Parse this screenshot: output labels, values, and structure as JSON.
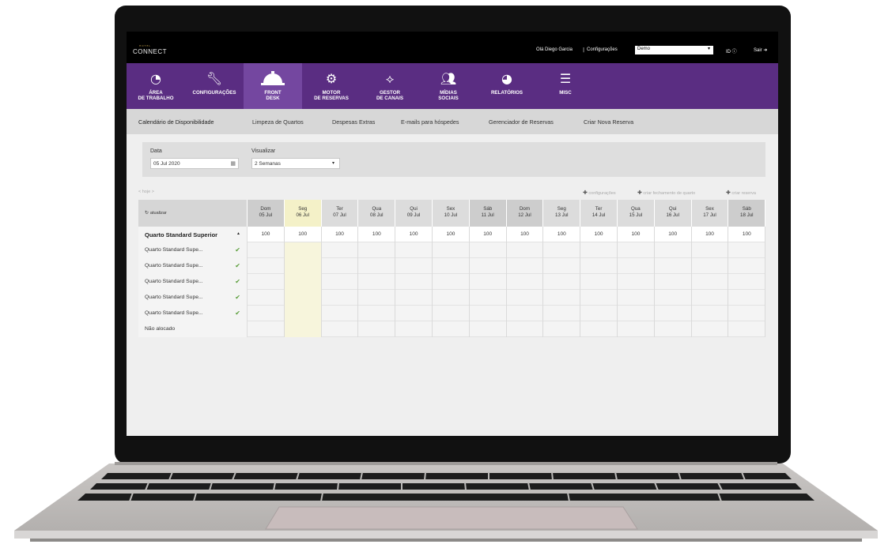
{
  "topbar": {
    "logo_small": "HOTEL",
    "logo": "CONNECT",
    "greeting": "Olá Diego Garcia",
    "separator": "|",
    "config_link": "Configurações",
    "property_select": "Demo",
    "id_label": "ID",
    "logout_label": "Sair"
  },
  "nav": {
    "items": [
      {
        "label": "ÁREA\nDE TRABALHO",
        "icon": "dashboard-gauge-icon"
      },
      {
        "label": "CONFIGURAÇÕES",
        "icon": "wrench-icon"
      },
      {
        "label": "FRONT\nDESK",
        "icon": "service-bell-icon"
      },
      {
        "label": "MOTOR\nDE RESERVAS",
        "icon": "gear-icon"
      },
      {
        "label": "GESTOR\nDE CANAIS",
        "icon": "network-icon"
      },
      {
        "label": "MÍDIAS\nSOCIAIS",
        "icon": "people-icon"
      },
      {
        "label": "RELATÓRIOS",
        "icon": "pie-chart-icon"
      },
      {
        "label": "MISC",
        "icon": "menu-lines-icon"
      }
    ],
    "active_index": 2
  },
  "subnav": {
    "items": [
      "Calendário de Disponibilidade",
      "Limpeza de Quartos",
      "Despesas Extras",
      "E-mails para hóspedes",
      "Gerenciador de Reservas",
      "Criar Nova Reserva"
    ]
  },
  "filter": {
    "date_label": "Data",
    "date_value": "05 Jul 2020",
    "view_label": "Visualizar",
    "view_value": "2 Semanas"
  },
  "toolbar": {
    "prev": "<",
    "today": "hoje",
    "next": ">",
    "settings": "configurações",
    "close_room": "criar fechamento de quarto",
    "create_booking": "criar reserva",
    "refresh": "atualizar"
  },
  "calendar": {
    "days": [
      {
        "dow": "Dom",
        "date": "05 Jul"
      },
      {
        "dow": "Seg",
        "date": "06 Jul"
      },
      {
        "dow": "Ter",
        "date": "07 Jul"
      },
      {
        "dow": "Qua",
        "date": "08 Jul"
      },
      {
        "dow": "Qui",
        "date": "09 Jul"
      },
      {
        "dow": "Sex",
        "date": "10 Jul"
      },
      {
        "dow": "Sáb",
        "date": "11 Jul"
      },
      {
        "dow": "Dom",
        "date": "12 Jul"
      },
      {
        "dow": "Seg",
        "date": "13 Jul"
      },
      {
        "dow": "Ter",
        "date": "14 Jul"
      },
      {
        "dow": "Qua",
        "date": "15 Jul"
      },
      {
        "dow": "Qui",
        "date": "16 Jul"
      },
      {
        "dow": "Sex",
        "date": "17 Jul"
      },
      {
        "dow": "Sáb",
        "date": "18 Jul"
      }
    ],
    "room_type": "Quarto Standard Superior",
    "availability": [
      "100",
      "100",
      "100",
      "100",
      "100",
      "100",
      "100",
      "100",
      "100",
      "100",
      "100",
      "100",
      "100",
      "100"
    ],
    "rooms": [
      "Quarto Standard Supe...",
      "Quarto Standard Supe...",
      "Quarto Standard Supe...",
      "Quarto Standard Supe...",
      "Quarto Standard Supe..."
    ],
    "unallocated": "Não alocado"
  },
  "colors": {
    "nav_bg": "#5a2d82",
    "nav_active": "#7447a0",
    "today_highlight": "#f4f1c8",
    "check": "#5a9e3a"
  }
}
